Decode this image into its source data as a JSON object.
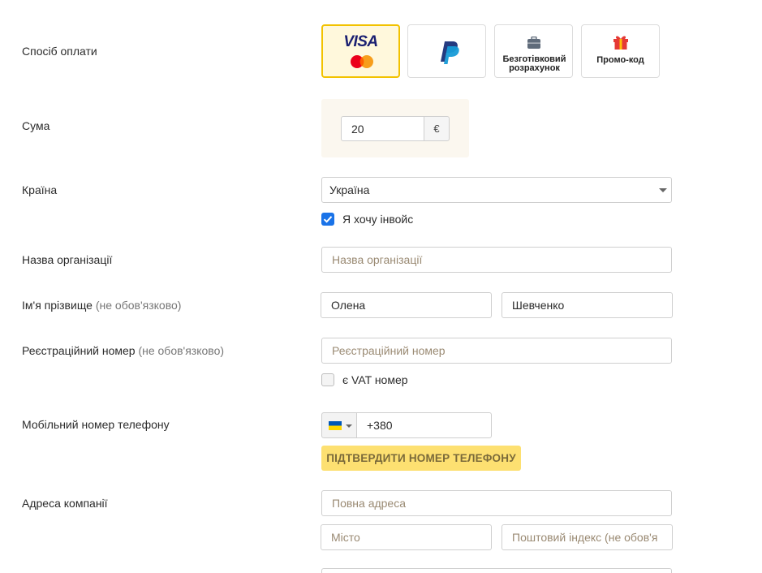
{
  "payment": {
    "label": "Спосіб оплати",
    "methods": [
      {
        "id": "card",
        "visa_text": "VISA",
        "selected": true
      },
      {
        "id": "paypal"
      },
      {
        "id": "bank",
        "label": "Безготівковий розрахунок"
      },
      {
        "id": "promo",
        "label": "Промо-код"
      }
    ]
  },
  "amount": {
    "label": "Сума",
    "value": "20",
    "currency": "€"
  },
  "country": {
    "label": "Країна",
    "value": "Україна",
    "invoice_label": "Я хочу інвойс",
    "invoice_checked": true
  },
  "organization": {
    "label": "Назва організації",
    "placeholder": "Назва організації"
  },
  "name": {
    "label": "Ім'я прізвище",
    "optional": "(не обов'язково)",
    "first": "Олена",
    "last": "Шевченко"
  },
  "registration": {
    "label": "Реєстраційний номер",
    "optional": "(не обов'язково)",
    "placeholder": "Реєстраційний номер",
    "vat_label": "є VAT номер",
    "vat_checked": false
  },
  "phone": {
    "label": "Мобільний номер телефону",
    "value": "+380",
    "confirm_label": "ПІДТВЕРДИТИ НОМЕР ТЕЛЕФОНУ"
  },
  "address": {
    "label": "Адреса компанії",
    "full_placeholder": "Повна адреса",
    "city_placeholder": "Місто",
    "zip_placeholder": "Поштовий індекс (не обов'я"
  },
  "colors": {
    "accent": "#f2c200",
    "button": "#fde071",
    "checkbox": "#1a73e8"
  }
}
